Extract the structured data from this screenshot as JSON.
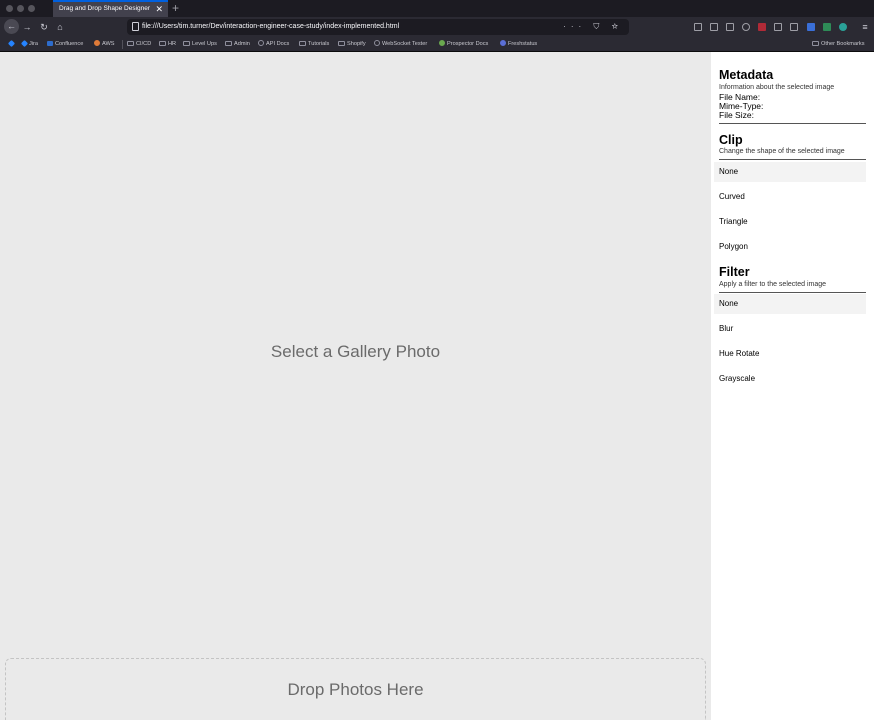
{
  "browser": {
    "tab_title": "Drag and Drop Shape Designer",
    "tab_close": "✕",
    "new_tab": "+",
    "url": "file:///Users/tim.turner/Dev/interaction-engineer-case-study/index-implemented.html",
    "url_actions": "··· ⛉ ☆",
    "bookmarks": [
      {
        "label": "Jira",
        "icon": "jira-icon"
      },
      {
        "label": "Confluence",
        "icon": "confluence-icon"
      },
      {
        "label": "AWS",
        "icon": "aws-icon"
      },
      {
        "label": "CI/CD",
        "icon": "folder-icon"
      },
      {
        "label": "HR",
        "icon": "folder-icon"
      },
      {
        "label": "Level Ups",
        "icon": "folder-icon"
      },
      {
        "label": "Admin",
        "icon": "folder-icon"
      },
      {
        "label": "API Docs",
        "icon": "globe-icon"
      },
      {
        "label": "Tutorials",
        "icon": "folder-icon"
      },
      {
        "label": "Shopify",
        "icon": "folder-icon"
      },
      {
        "label": "WebSocket Tester",
        "icon": "websocket-icon"
      },
      {
        "label": "Prospector Docs",
        "icon": "prospector-icon"
      },
      {
        "label": "Freshstatus",
        "icon": "freshstatus-icon"
      }
    ],
    "other_bookmarks": "Other Bookmarks"
  },
  "workspace": {
    "title": "Select a Gallery Photo",
    "dropzone_label": "Drop Photos Here"
  },
  "sidebar": {
    "metadata": {
      "title": "Metadata",
      "description": "Information about the selected image",
      "file_name_label": "File Name:",
      "mime_type_label": "Mime-Type:",
      "file_size_label": "File Size:"
    },
    "clip": {
      "title": "Clip",
      "description": "Change the shape of the selected image",
      "options": [
        "None",
        "Curved",
        "Triangle",
        "Polygon"
      ],
      "selected": "None"
    },
    "filter": {
      "title": "Filter",
      "description": "Apply a filter to the selected image",
      "options": [
        "None",
        "Blur",
        "Hue Rotate",
        "Grayscale"
      ],
      "selected": "None"
    }
  }
}
